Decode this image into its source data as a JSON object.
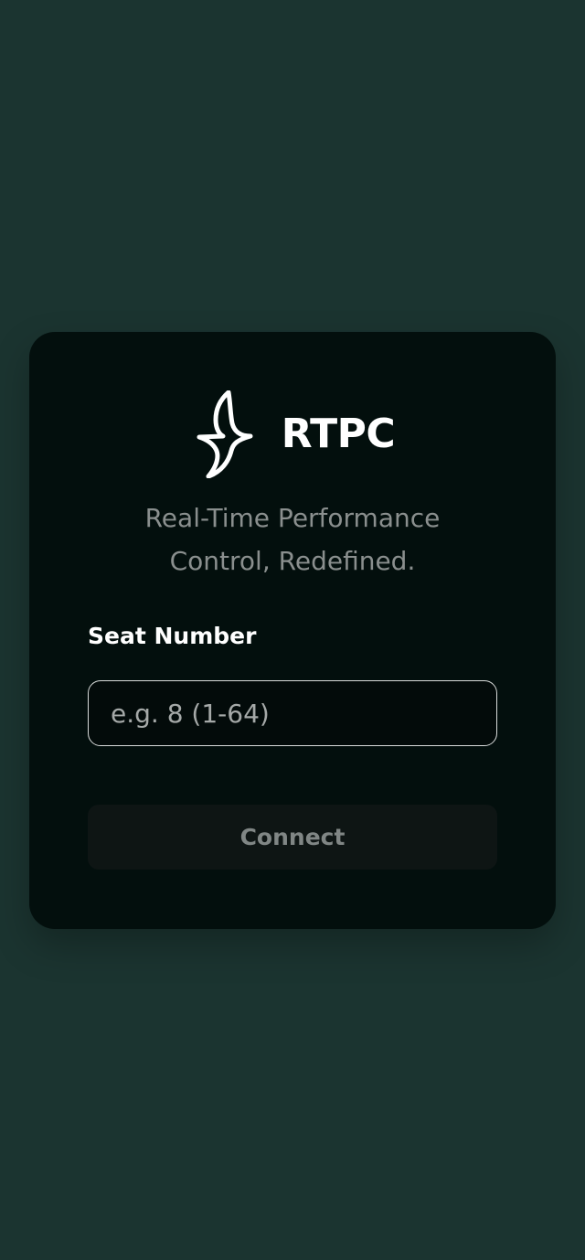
{
  "brand": {
    "name": "RTPC",
    "logo_icon": "rtpc-logo-icon"
  },
  "tagline": {
    "line1": "Real-Time Performance",
    "line2": "Control, Redefined."
  },
  "form": {
    "seat_label": "Seat Number",
    "seat_value": "",
    "seat_placeholder": "e.g. 8 (1-64)",
    "connect_label": "Connect",
    "connect_enabled": false
  },
  "colors": {
    "background": "#1b3430",
    "card": "#030f0d",
    "text_primary": "#ffffff",
    "text_muted": "#8a8f8e",
    "input_border": "#d9dcdb",
    "button_disabled_bg": "#0e1514",
    "button_disabled_text": "#808685"
  }
}
